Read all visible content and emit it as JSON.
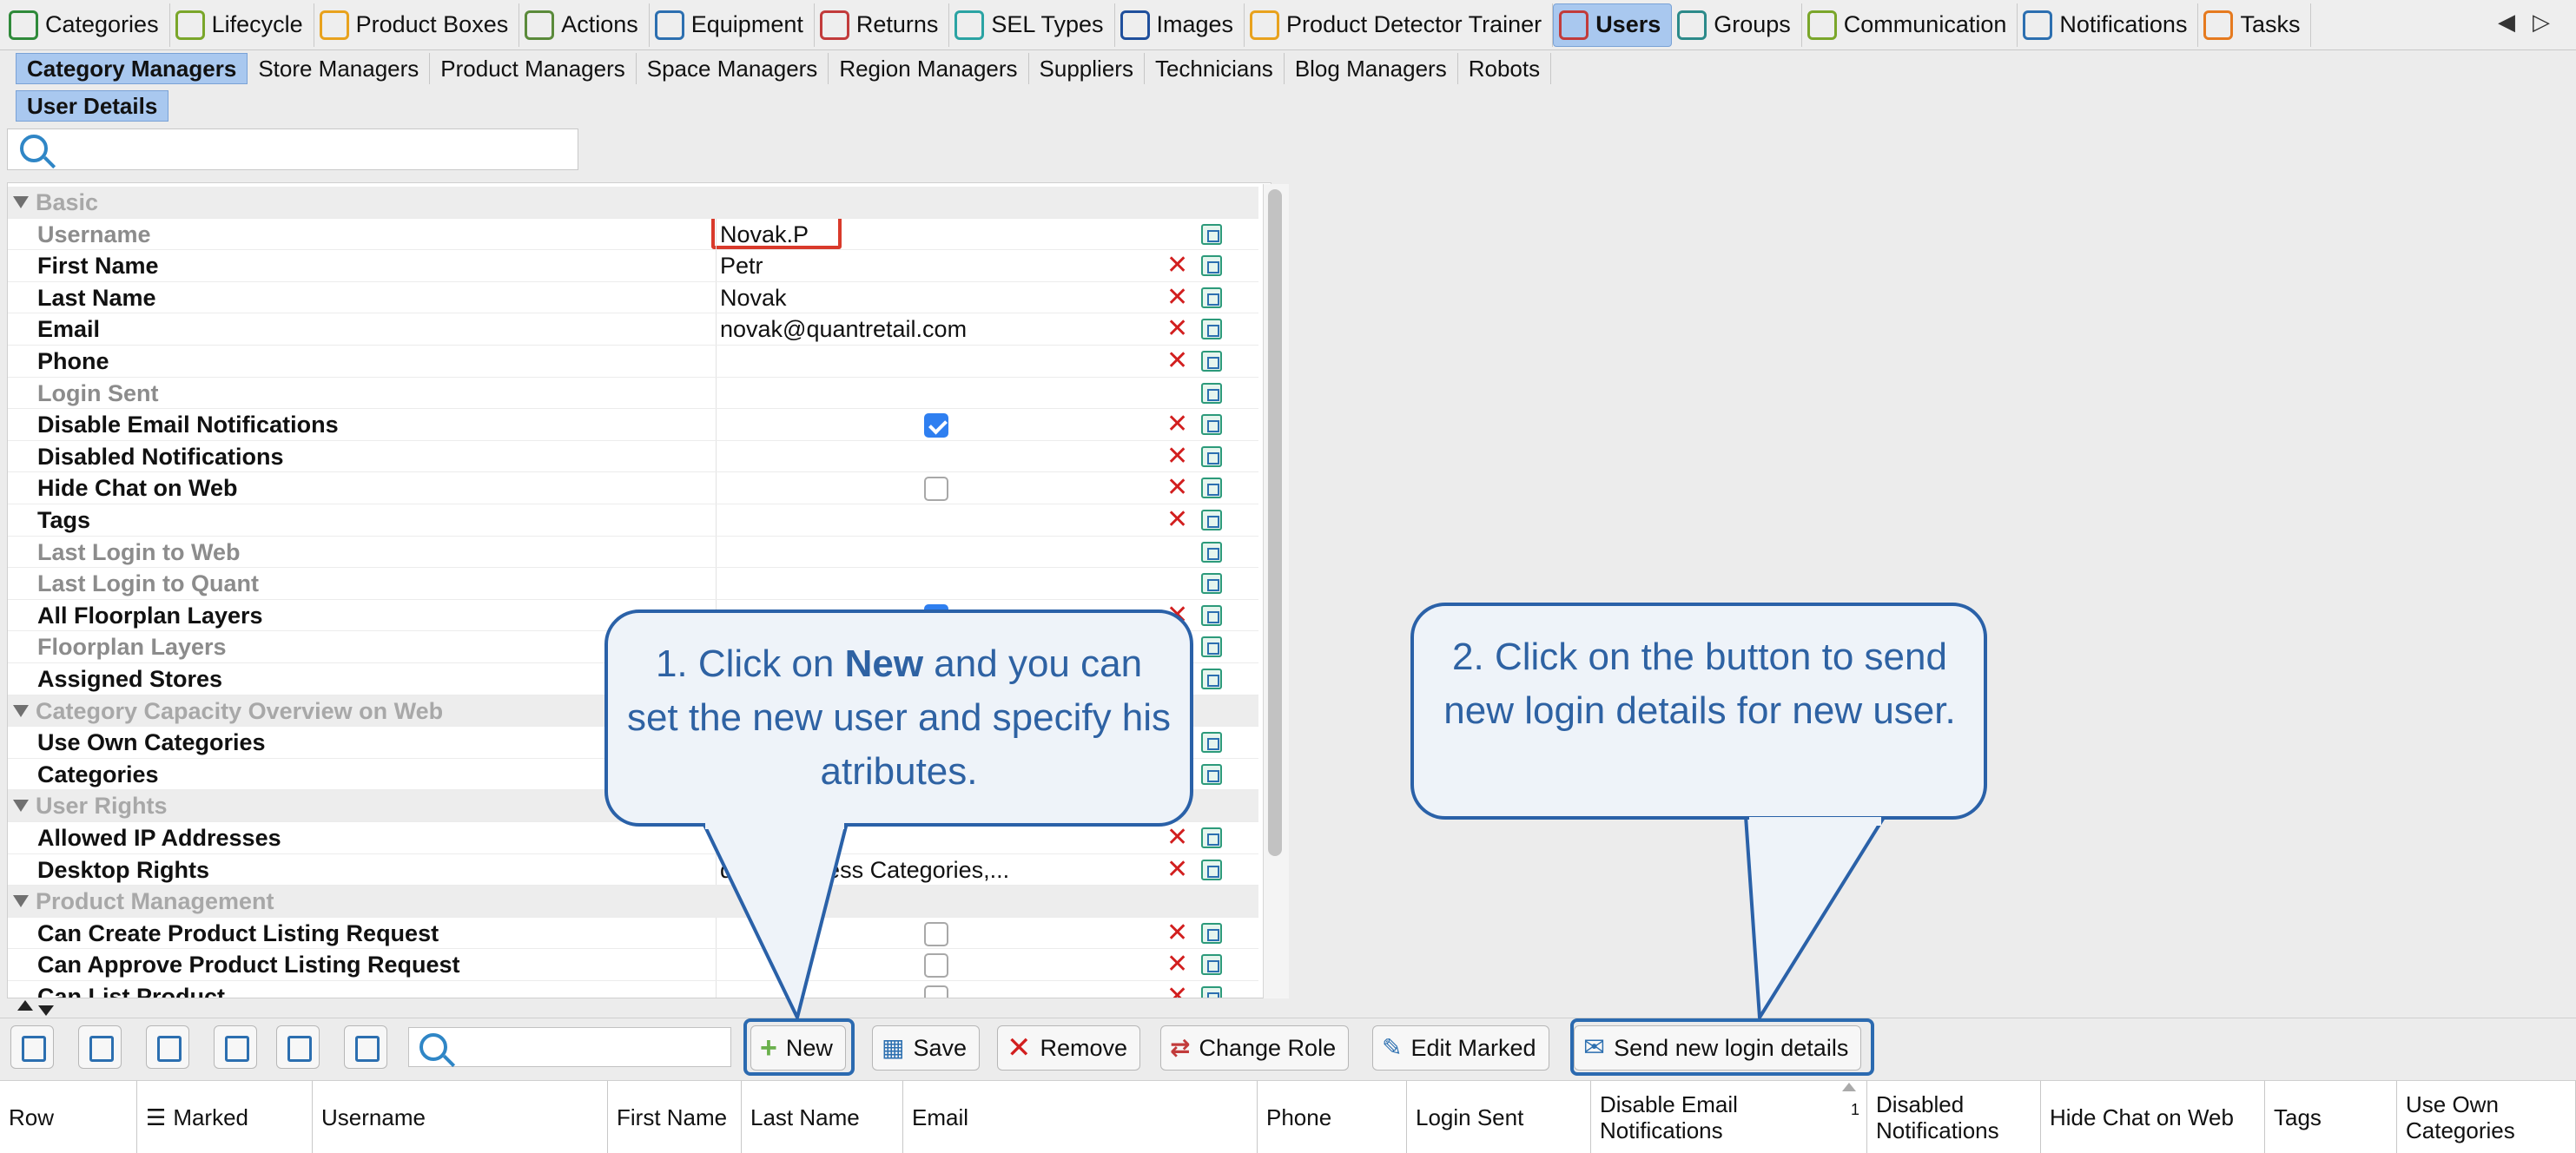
{
  "top_tabs": [
    {
      "label": "Categories",
      "icon": "categories-icon",
      "color": "#2f8a3a"
    },
    {
      "label": "Lifecycle",
      "icon": "lifecycle-icon",
      "color": "#7aa62a"
    },
    {
      "label": "Product Boxes",
      "icon": "product-boxes-icon",
      "color": "#e8a21d"
    },
    {
      "label": "Actions",
      "icon": "actions-icon",
      "color": "#5a8a3a"
    },
    {
      "label": "Equipment",
      "icon": "equipment-icon",
      "color": "#2c6fb0"
    },
    {
      "label": "Returns",
      "icon": "returns-icon",
      "color": "#c23b3b"
    },
    {
      "label": "SEL Types",
      "icon": "sel-types-icon",
      "color": "#2aa3a3"
    },
    {
      "label": "Images",
      "icon": "images-icon",
      "color": "#1f4f9c"
    },
    {
      "label": "Product Detector Trainer",
      "icon": "product-detector-icon",
      "color": "#e8a21d"
    },
    {
      "label": "Users",
      "icon": "users-icon",
      "color": "#c23b3b",
      "active": true
    },
    {
      "label": "Groups",
      "icon": "groups-icon",
      "color": "#2c8a8a"
    },
    {
      "label": "Communication",
      "icon": "communication-icon",
      "color": "#7aa62a"
    },
    {
      "label": "Notifications",
      "icon": "notifications-icon",
      "color": "#2c6fb0"
    },
    {
      "label": "Tasks",
      "icon": "tasks-icon",
      "color": "#e57a1f"
    }
  ],
  "sub_tabs": [
    {
      "label": "Category Managers",
      "active": true
    },
    {
      "label": "Store Managers"
    },
    {
      "label": "Product Managers"
    },
    {
      "label": "Space Managers"
    },
    {
      "label": "Region Managers"
    },
    {
      "label": "Suppliers"
    },
    {
      "label": "Technicians"
    },
    {
      "label": "Blog Managers"
    },
    {
      "label": "Robots"
    }
  ],
  "detail_tab": "User Details",
  "properties": [
    {
      "kind": "group",
      "label": "Basic"
    },
    {
      "label": "Username",
      "value": "Novak.P",
      "gray": true,
      "clear": false
    },
    {
      "label": "First Name",
      "value": "Petr",
      "clear": true
    },
    {
      "label": "Last Name",
      "value": "Novak",
      "clear": true
    },
    {
      "label": "Email",
      "value": "novak@quantretail.com",
      "clear": true
    },
    {
      "label": "Phone",
      "value": "",
      "clear": true
    },
    {
      "label": "Login Sent",
      "value": "",
      "gray": true,
      "clear": false
    },
    {
      "label": "Disable Email Notifications",
      "checkbox": true,
      "checked": true,
      "clear": true
    },
    {
      "label": "Disabled Notifications",
      "value": "",
      "clear": true
    },
    {
      "label": "Hide Chat on Web",
      "checkbox": true,
      "checked": false,
      "clear": true
    },
    {
      "label": "Tags",
      "value": "",
      "clear": true
    },
    {
      "label": "Last Login to Web",
      "value": "",
      "gray": true,
      "clear": false
    },
    {
      "label": "Last Login to Quant",
      "value": "",
      "gray": true,
      "clear": false
    },
    {
      "label": "All Floorplan Layers",
      "checkbox": true,
      "checked": true,
      "clear": true
    },
    {
      "label": "Floorplan Layers",
      "value": "",
      "gray": true,
      "clear": false
    },
    {
      "label": "Assigned Stores",
      "value": "",
      "clear": false
    },
    {
      "kind": "group",
      "label": "Category Capacity Overview on Web"
    },
    {
      "label": "Use Own Categories",
      "value": "",
      "clear": false
    },
    {
      "label": "Categories",
      "value": "",
      "clear": false
    },
    {
      "kind": "group",
      "label": "User Rights"
    },
    {
      "label": "Allowed IP Addresses",
      "value": "",
      "clear": true
    },
    {
      "label": "Desktop Rights",
      "value": "ducts, Access Categories,...",
      "clear": true
    },
    {
      "kind": "group",
      "label": "Product Management"
    },
    {
      "label": "Can Create Product Listing Request",
      "checkbox": true,
      "checked": false,
      "clear": true
    },
    {
      "label": "Can Approve Product Listing Request",
      "checkbox": true,
      "checked": false,
      "clear": true
    },
    {
      "label": "Can List Product",
      "checkbox": true,
      "checked": false,
      "clear": true
    }
  ],
  "toolbar": {
    "new_label": "New",
    "save_label": "Save",
    "remove_label": "Remove",
    "change_role_label": "Change Role",
    "edit_marked_label": "Edit Marked",
    "send_login_label": "Send new login details",
    "search_value": ""
  },
  "columns": [
    "Row",
    "Marked",
    "Username",
    "First Name",
    "Last Name",
    "Email",
    "Phone",
    "Login Sent",
    "Disable Email Notifications",
    "Disabled Notifications",
    "Hide Chat on Web",
    "Tags",
    "Use Own Categories"
  ],
  "sort_badge": "1",
  "callouts": {
    "one_pre": "1. Click on ",
    "one_bold": "New",
    "one_post": " and you can set the new user and specify his atributes.",
    "two": "2. Click on the button to send new login details for new user."
  }
}
